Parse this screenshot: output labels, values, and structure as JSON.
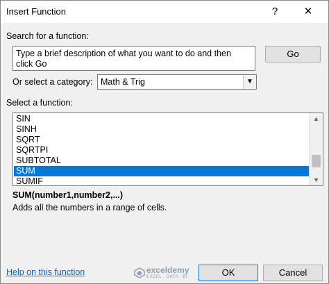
{
  "dialog": {
    "title": "Insert Function",
    "help_glyph": "?",
    "close_glyph": "✕"
  },
  "search": {
    "label": "Search for a function:",
    "value_line1": "Type a brief description of what you want to do and then",
    "value_line2": "click Go",
    "go_label": "Go"
  },
  "category": {
    "label": "Or select a category:",
    "selected": "Math & Trig"
  },
  "functions": {
    "label": "Select a function:",
    "items": [
      "SIN",
      "SINH",
      "SQRT",
      "SQRTPI",
      "SUBTOTAL",
      "SUM",
      "SUMIF"
    ],
    "selected": "SUM"
  },
  "details": {
    "signature": "SUM(number1,number2,...)",
    "description": "Adds all the numbers in a range of cells."
  },
  "footer": {
    "help_link": "Help on this function",
    "ok_label": "OK",
    "cancel_label": "Cancel"
  },
  "watermark": {
    "name": "exceldemy",
    "tagline": "EXCEL · DATA · BI"
  },
  "colors": {
    "selection": "#0078d7",
    "link": "#0066cc"
  }
}
